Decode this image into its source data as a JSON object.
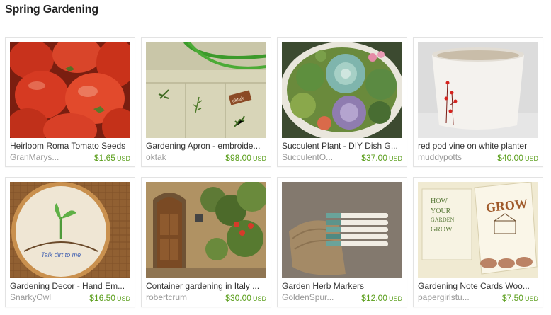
{
  "page": {
    "title": "Spring Gardening"
  },
  "accent_colors": {
    "price": "#5a9e1b",
    "shop": "#999999",
    "title": "#333333"
  },
  "items": [
    {
      "title": "Heirloom Roma Tomato Seeds",
      "shop": "GranMarys...",
      "price": "$1.65",
      "currency": "USD",
      "image": "red-tomatoes-photo"
    },
    {
      "title": "Gardening Apron - embroide...",
      "shop": "oktak",
      "price": "$98.00",
      "currency": "USD",
      "image": "linen-apron-photo"
    },
    {
      "title": "Succulent Plant - DIY Dish G...",
      "shop": "SucculentO...",
      "price": "$37.00",
      "currency": "USD",
      "image": "succulent-dish-photo"
    },
    {
      "title": "red pod vine on white planter",
      "shop": "muddypotts",
      "price": "$40.00",
      "currency": "USD",
      "image": "white-planter-photo"
    },
    {
      "title": "Gardening Decor - Hand Em...",
      "shop": "SnarkyOwl",
      "price": "$16.50",
      "currency": "USD",
      "image": "embroidery-hoop-photo",
      "image_text": "Talk dirt to me"
    },
    {
      "title": "Container gardening in Italy ...",
      "shop": "robertcrum",
      "price": "$30.00",
      "currency": "USD",
      "image": "italian-doorway-photo"
    },
    {
      "title": "Garden Herb Markers",
      "shop": "GoldenSpur...",
      "price": "$12.00",
      "currency": "USD",
      "image": "herb-markers-photo"
    },
    {
      "title": "Gardening Note Cards Woo...",
      "shop": "papergirlstu...",
      "price": "$7.50",
      "currency": "USD",
      "image": "note-cards-photo",
      "image_text": [
        "HOW",
        "YOUR",
        "GARDEN",
        "GROW",
        "GROW"
      ]
    }
  ]
}
